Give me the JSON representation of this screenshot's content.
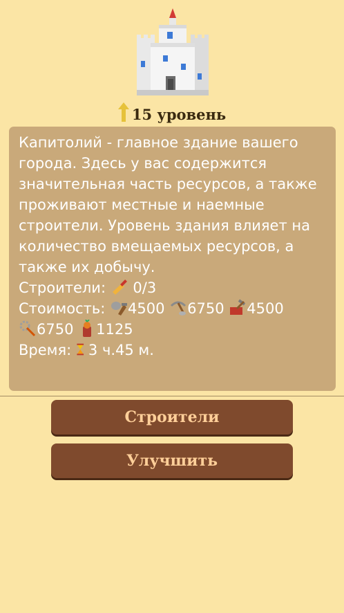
{
  "building": {
    "image_name": "castle-icon",
    "level_label": "15 уровень"
  },
  "info": {
    "description": "Капитолий - главное здание вашего города. Здесь у вас содержится значительная часть ресурсов, а также проживают местные и наемные строители. Уровень здания влияет на количество вмещаемых ресурсов, а также их добычу.",
    "builders_label": "Строители:",
    "builders_value": "0/3",
    "cost_label": "Стоимость:",
    "cost_stone": "4500",
    "cost_ore": "6750",
    "cost_brick": "4500",
    "cost_gear": "6750",
    "cost_food": "1125",
    "time_label": "Время:",
    "time_value": "3 ч.45 м."
  },
  "buttons": {
    "builders": "Строители",
    "upgrade": "Улучшить"
  },
  "colors": {
    "background": "#fbe5a5",
    "panel": "#c9a97a",
    "button": "#7f4a2d",
    "button_text": "#ffcf99"
  }
}
